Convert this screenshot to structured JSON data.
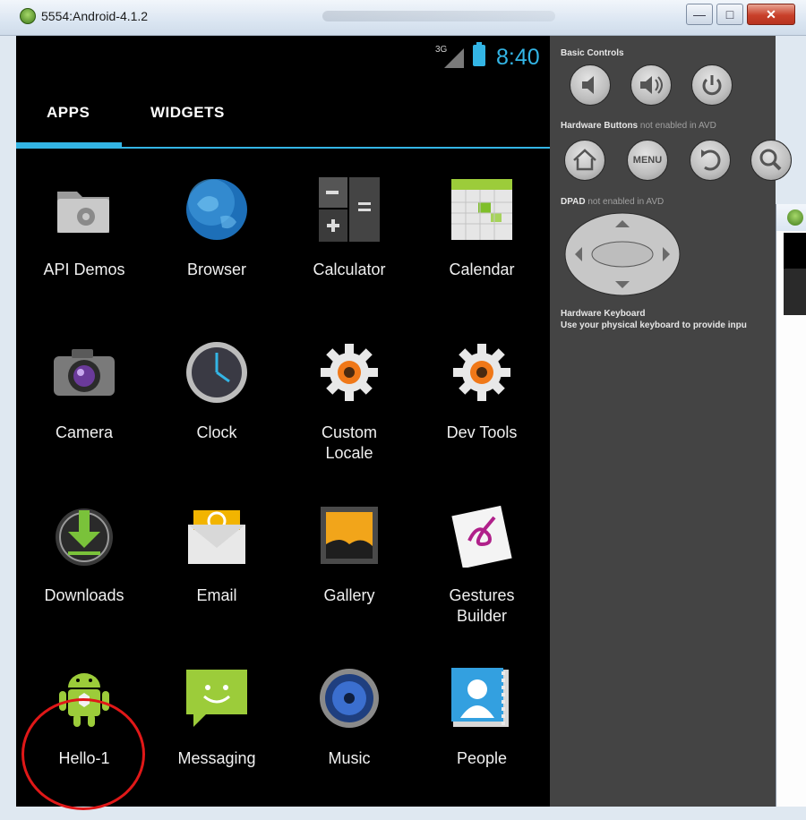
{
  "window": {
    "title": "5554:Android-4.1.2",
    "buttons": {
      "minimize": "—",
      "maximize": "□",
      "close": "✕"
    }
  },
  "status_bar": {
    "network": "3G",
    "time": "8:40"
  },
  "tabs": [
    {
      "label": "APPS",
      "selected": true
    },
    {
      "label": "WIDGETS",
      "selected": false
    }
  ],
  "apps": [
    {
      "label": "API Demos",
      "icon": "folder-gear-icon"
    },
    {
      "label": "Browser",
      "icon": "globe-icon"
    },
    {
      "label": "Calculator",
      "icon": "calculator-icon"
    },
    {
      "label": "Calendar",
      "icon": "calendar-icon"
    },
    {
      "label": "Camera",
      "icon": "camera-icon"
    },
    {
      "label": "Clock",
      "icon": "clock-icon"
    },
    {
      "label": "Custom\nLocale",
      "icon": "gear-icon"
    },
    {
      "label": "Dev Tools",
      "icon": "gear-icon"
    },
    {
      "label": "Downloads",
      "icon": "download-icon"
    },
    {
      "label": "Email",
      "icon": "email-icon"
    },
    {
      "label": "Gallery",
      "icon": "gallery-icon"
    },
    {
      "label": "Gestures\nBuilder",
      "icon": "gestures-icon"
    },
    {
      "label": "Hello-1",
      "icon": "android-robot-icon"
    },
    {
      "label": "Messaging",
      "icon": "message-icon"
    },
    {
      "label": "Music",
      "icon": "speaker-icon"
    },
    {
      "label": "People",
      "icon": "contacts-icon"
    }
  ],
  "controls": {
    "basic_controls_title": "Basic Controls",
    "basic_buttons": [
      {
        "name": "volume-down",
        "icon": "volume-down-icon"
      },
      {
        "name": "volume-up",
        "icon": "volume-up-icon"
      },
      {
        "name": "power",
        "icon": "power-icon"
      }
    ],
    "hardware_title": "Hardware Buttons",
    "hardware_note": "not enabled in AVD",
    "hardware_buttons": [
      {
        "name": "home",
        "icon": "home-icon"
      },
      {
        "name": "menu",
        "label": "MENU",
        "icon": "menu-icon"
      },
      {
        "name": "back",
        "icon": "back-icon"
      },
      {
        "name": "search",
        "icon": "search-icon"
      }
    ],
    "dpad_title": "DPAD",
    "dpad_note": "not enabled in AVD",
    "keyboard_title": "Hardware Keyboard",
    "keyboard_note": "Use your physical keyboard to provide inpu"
  }
}
